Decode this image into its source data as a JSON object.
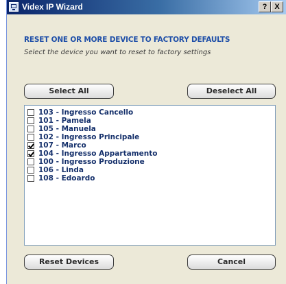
{
  "window": {
    "title": "Videx IP Wizard",
    "help_label": "?",
    "close_label": "X"
  },
  "dialog": {
    "heading": "RESET ONE OR MORE DEVICE TO FACTORY DEFAULTS",
    "subheading": "Select the device you want to reset to factory settings"
  },
  "buttons": {
    "select_all": "Select All",
    "deselect_all": "Deselect All",
    "reset_devices": "Reset Devices",
    "cancel": "Cancel"
  },
  "devices": [
    {
      "label": "103 -  Ingresso Cancello",
      "checked": false
    },
    {
      "label": "101 -  Pamela",
      "checked": false
    },
    {
      "label": "105 -  Manuela",
      "checked": false
    },
    {
      "label": "102 -  Ingresso Principale",
      "checked": false
    },
    {
      "label": "107 -  Marco",
      "checked": true
    },
    {
      "label": "104 -  Ingresso Appartamento",
      "checked": true
    },
    {
      "label": "100 -  Ingresso Produzione",
      "checked": false
    },
    {
      "label": "106 -  Linda",
      "checked": false
    },
    {
      "label": "108 -  Edoardo",
      "checked": false
    }
  ]
}
